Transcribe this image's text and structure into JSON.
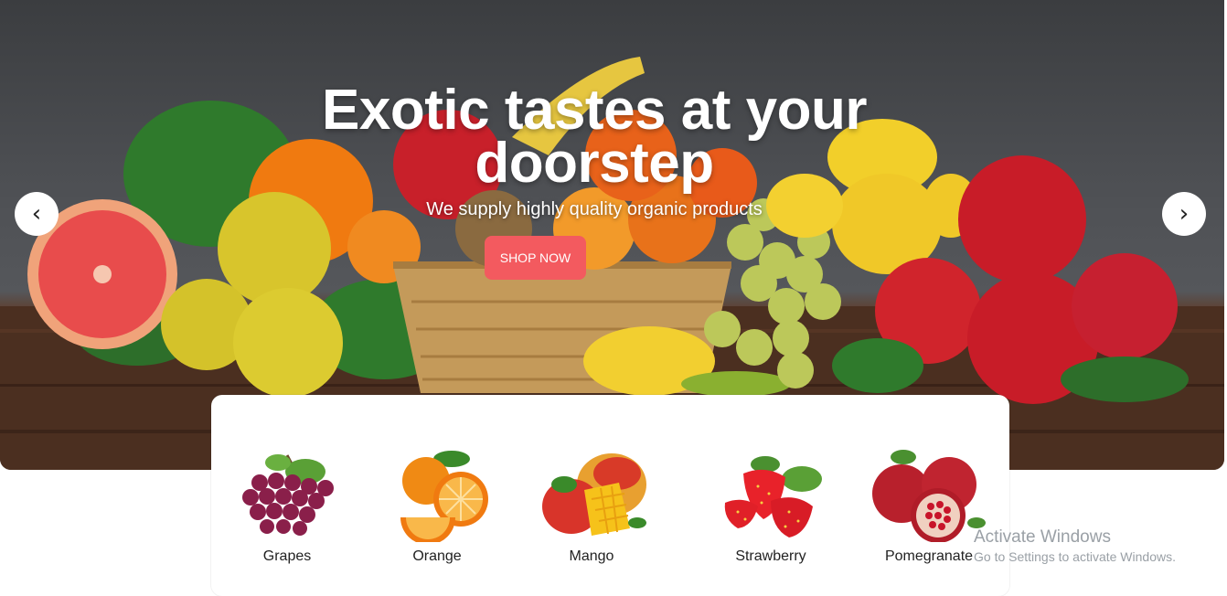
{
  "hero": {
    "title": "Exotic tastes at your doorstep",
    "subtitle": "We supply highly quality organic products",
    "cta_label": "SHOP NOW",
    "prev_symbol": "‹",
    "next_symbol": "›",
    "accent_color": "#f35a5f"
  },
  "categories": [
    {
      "label": "Grapes",
      "icon": "grapes-icon"
    },
    {
      "label": "Orange",
      "icon": "orange-icon"
    },
    {
      "label": "Mango",
      "icon": "mango-icon"
    },
    {
      "label": "Strawberry",
      "icon": "strawberry-icon"
    },
    {
      "label": "Pomegranate",
      "icon": "pomegranate-icon"
    }
  ],
  "watermark": {
    "title": "Activate Windows",
    "subtitle": "Go to Settings to activate Windows."
  }
}
